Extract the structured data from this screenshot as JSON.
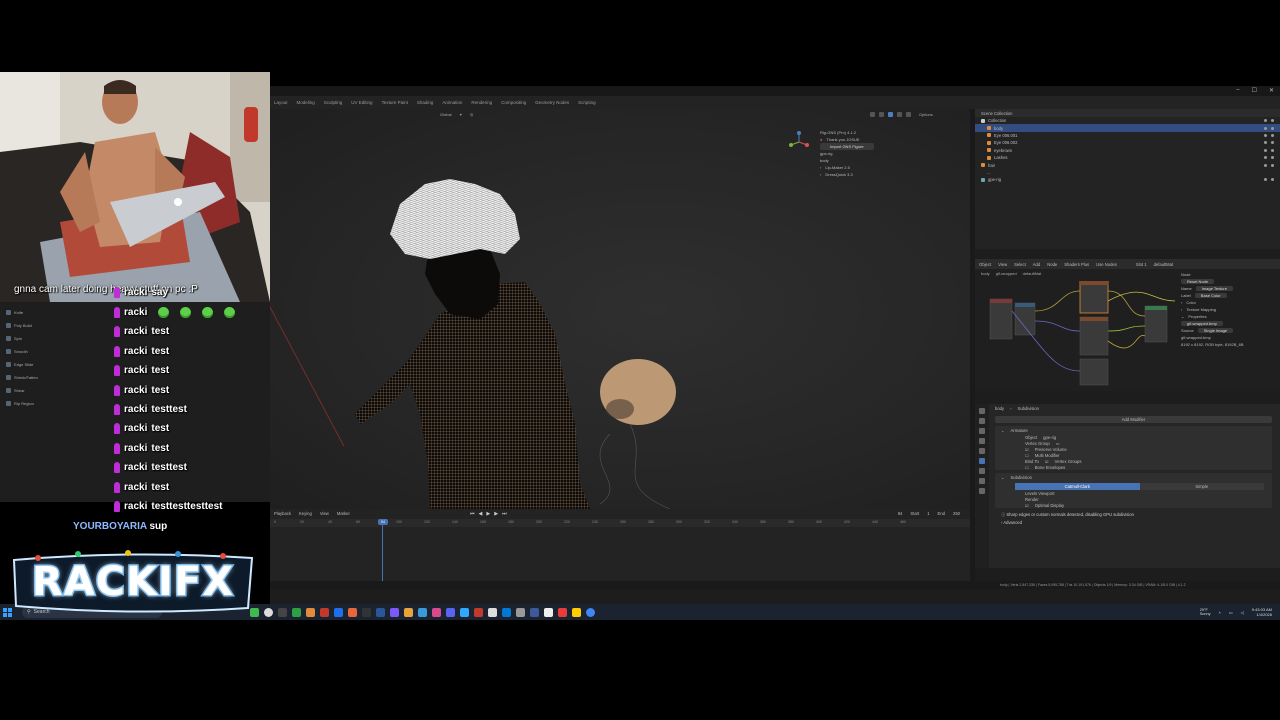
{
  "blender": {
    "workspace_tabs": [
      "Layout",
      "Modeling",
      "Sculpting",
      "UV Editing",
      "Texture Paint",
      "Shading",
      "Animation",
      "Rendering",
      "Compositing",
      "Geometry Nodes",
      "Scripting"
    ],
    "viewport": {
      "orientation": "Global",
      "options": "Options",
      "n_panel": {
        "addon": "Rig-GNS (Pro) 4.1.2",
        "thanks": "Thank you JOSUE",
        "import_button": "Import GNS Figure",
        "field1": "gpe-rig",
        "field2": "body",
        "section1": "Lip-Maker 2.5",
        "section2": "DressQuick 3.3"
      }
    },
    "outliner": {
      "title": "Scene Collection",
      "items": [
        "Collection",
        "body",
        "Eye 006.001",
        "Eye 006.002",
        "eyebrows",
        "Lashes",
        "hair",
        "...",
        "gpe-rig"
      ]
    },
    "node_editor": {
      "menu": [
        "Object",
        "View",
        "Select",
        "Add",
        "Node",
        "Shaders Plus",
        "Use Nodes"
      ],
      "material": "defaultMat",
      "slot": "Slot 1",
      "tabs": [
        "body",
        "gif-wrapped",
        "defaultMat"
      ],
      "side": {
        "header": "Node",
        "reset": "Reset Node",
        "name_label": "Name",
        "name_value": "Image Texture",
        "label_label": "Label",
        "label_value": "Base Color",
        "color": "Color",
        "texture_mapping": "Texture Mapping",
        "properties": "Properties",
        "image": "gif-wrapped.bmp",
        "source_label": "Source",
        "source_value": "Single Image",
        "file": "gif-wrapped.bmp",
        "info": "8192 x 8192, RGB byte, 8192B_6B"
      }
    },
    "properties": {
      "breadcrumb": [
        "body",
        "Subdivision"
      ],
      "add_modifier": "Add Modifier",
      "armature": {
        "name": "Armature",
        "object_label": "Object",
        "object_value": "gpe-rig",
        "vertex_group_label": "Vertex Group",
        "preserve_volume": "Preserve Volume",
        "multi_modifier": "Multi Modifier",
        "bind_to_label": "Bind To",
        "vertex_groups": "Vertex Groups",
        "bone_envelopes": "Bone Envelopes"
      },
      "subdivision": {
        "name": "Subdivision",
        "tab_active": "Catmull-Clark",
        "tab_other": "Simple",
        "levels_viewport": "Levels Viewport",
        "render": "Render",
        "optimal_display": "Optimal Display",
        "warning": "Sharp edges or custom normals detected, disabling GPU subdivision",
        "advanced": "Advanced"
      }
    },
    "timeline": {
      "menu": [
        "Playback",
        "Keying",
        "View",
        "Marker"
      ],
      "current_frame": "94",
      "start_label": "Start",
      "start": "1",
      "end_label": "End",
      "end": "250",
      "ticks": [
        "0",
        "20",
        "40",
        "60",
        "80",
        "100",
        "120",
        "140",
        "160",
        "180",
        "200",
        "220",
        "240",
        "260",
        "280",
        "300",
        "320",
        "340",
        "360",
        "380",
        "400",
        "420",
        "440",
        "460"
      ]
    },
    "status_bar": "body | Verts 2,547,335 | Faces 5,095,788 | Tris 10,191,576 | Objects 1/9 | Memory: 3.34 GiB | VRAM: 4.1/8.0 GiB | 4.1.2"
  },
  "tool_panel": [
    "Knife",
    "Poly Build",
    "Spin",
    "Smooth",
    "Edge Slide",
    "Shrink/Fatten",
    "Shear",
    "Rip Region"
  ],
  "chat": {
    "caption": "gnna cam later doing heavy stuff on pc :P",
    "messages": [
      {
        "user": "racki",
        "text": "say"
      },
      {
        "user": "racki",
        "text": ""
      },
      {
        "user": "racki",
        "text": "test"
      },
      {
        "user": "racki",
        "text": "test"
      },
      {
        "user": "racki",
        "text": "test"
      },
      {
        "user": "racki",
        "text": "test"
      },
      {
        "user": "racki",
        "text": "testtest"
      },
      {
        "user": "racki",
        "text": "test"
      },
      {
        "user": "racki",
        "text": "test"
      },
      {
        "user": "racki",
        "text": "testtest"
      },
      {
        "user": "racki",
        "text": "test"
      },
      {
        "user": "racki",
        "text": "testtesttesttest"
      }
    ],
    "other_user": "YOURBOYARIA",
    "other_text": "sup"
  },
  "logo": "RACKIFX",
  "taskbar": {
    "search": "Search",
    "weather_temp": "29°F",
    "weather_desc": "Sunny",
    "time": "9:43:03 AM",
    "date": "1/4/2026"
  },
  "colors": {
    "accent": "#4772b3",
    "badge": "#c02cd8",
    "emote": "#5dd04a"
  }
}
